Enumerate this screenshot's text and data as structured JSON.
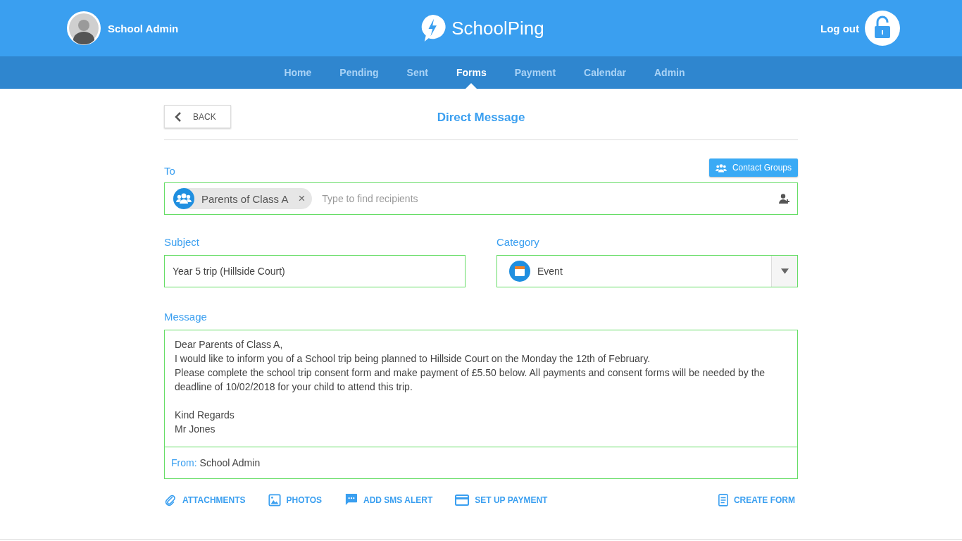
{
  "header": {
    "user": "School Admin",
    "logo": "SchoolPing",
    "logout": "Log out"
  },
  "nav": [
    {
      "label": "Home",
      "selected": false
    },
    {
      "label": "Pending",
      "selected": false
    },
    {
      "label": "Sent",
      "selected": false
    },
    {
      "label": "Forms",
      "selected": true
    },
    {
      "label": "Payment",
      "selected": false
    },
    {
      "label": "Calendar",
      "selected": false
    },
    {
      "label": "Admin",
      "selected": false
    }
  ],
  "back": "BACK",
  "title": "Direct Message",
  "to": {
    "label": "To",
    "contact_groups": "Contact Groups",
    "chips": [
      "Parents of Class A"
    ],
    "chip_remove": "×",
    "placeholder": "Type to find recipients"
  },
  "subject": {
    "label": "Subject",
    "value": "Year 5 trip (Hillside Court)"
  },
  "category": {
    "label": "Category",
    "value": "Event"
  },
  "message": {
    "label": "Message",
    "paragraphs": [
      [
        "Dear Parents of Class A,",
        "I would like to inform you of a School trip being planned to Hillside Court on the Monday the 12th of February.",
        "Please complete the school trip consent form and make payment of £5.50 below. All payments and consent forms will be needed by the deadline of 10/02/2018 for your child to attend this trip."
      ],
      [
        "Kind Regards",
        "Mr Jones"
      ]
    ],
    "from_label": "From:",
    "from_value": "School Admin"
  },
  "actions": [
    {
      "kind": "paperclip",
      "label": "ATTACHMENTS"
    },
    {
      "kind": "image",
      "label": "PHOTOS"
    },
    {
      "kind": "chat",
      "label": "ADD SMS ALERT"
    },
    {
      "kind": "card",
      "label": "SET UP PAYMENT"
    }
  ],
  "create_form": {
    "kind": "document",
    "label": "CREATE FORM"
  }
}
